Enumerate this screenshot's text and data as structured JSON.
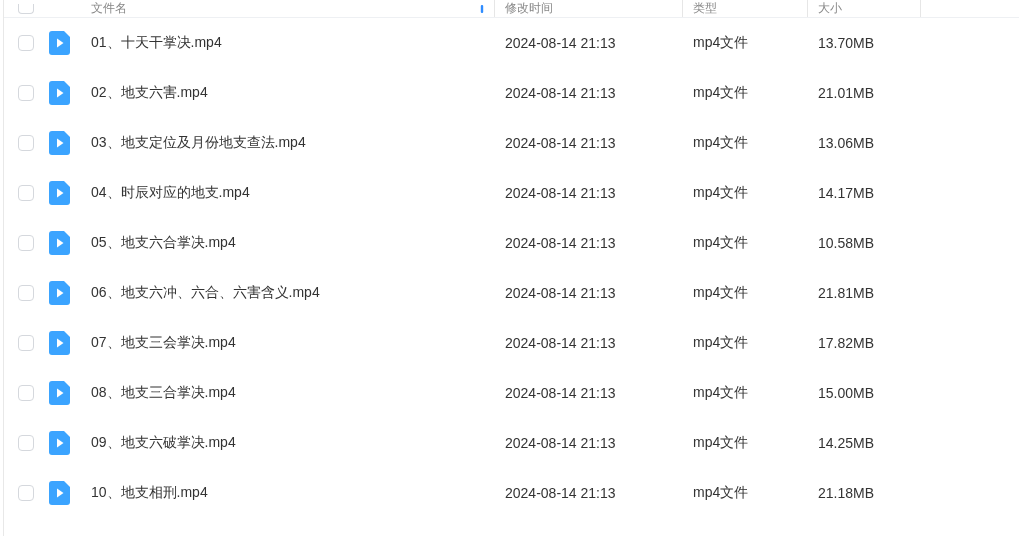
{
  "table": {
    "columns": [
      {
        "label": "文件名",
        "sorted": true
      },
      {
        "label": "修改时间",
        "sorted": false
      },
      {
        "label": "类型",
        "sorted": false
      },
      {
        "label": "大小",
        "sorted": false
      }
    ],
    "select_all": {
      "checked": false
    },
    "rows": [
      {
        "name": "01、十天干掌决.mp4",
        "modified": "2024-08-14 21:13",
        "type": "mp4文件",
        "size": "13.70MB",
        "checked": false
      },
      {
        "name": "02、地支六害.mp4",
        "modified": "2024-08-14 21:13",
        "type": "mp4文件",
        "size": "21.01MB",
        "checked": false
      },
      {
        "name": "03、地支定位及月份地支查法.mp4",
        "modified": "2024-08-14 21:13",
        "type": "mp4文件",
        "size": "13.06MB",
        "checked": false
      },
      {
        "name": "04、时辰对应的地支.mp4",
        "modified": "2024-08-14 21:13",
        "type": "mp4文件",
        "size": "14.17MB",
        "checked": false
      },
      {
        "name": "05、地支六合掌决.mp4",
        "modified": "2024-08-14 21:13",
        "type": "mp4文件",
        "size": "10.58MB",
        "checked": false
      },
      {
        "name": "06、地支六冲、六合、六害含义.mp4",
        "modified": "2024-08-14 21:13",
        "type": "mp4文件",
        "size": "21.81MB",
        "checked": false
      },
      {
        "name": "07、地支三会掌决.mp4",
        "modified": "2024-08-14 21:13",
        "type": "mp4文件",
        "size": "17.82MB",
        "checked": false
      },
      {
        "name": "08、地支三合掌决.mp4",
        "modified": "2024-08-14 21:13",
        "type": "mp4文件",
        "size": "15.00MB",
        "checked": false
      },
      {
        "name": "09、地支六破掌决.mp4",
        "modified": "2024-08-14 21:13",
        "type": "mp4文件",
        "size": "14.25MB",
        "checked": false
      },
      {
        "name": "10、地支相刑.mp4",
        "modified": "2024-08-14 21:13",
        "type": "mp4文件",
        "size": "21.18MB",
        "checked": false
      }
    ]
  }
}
